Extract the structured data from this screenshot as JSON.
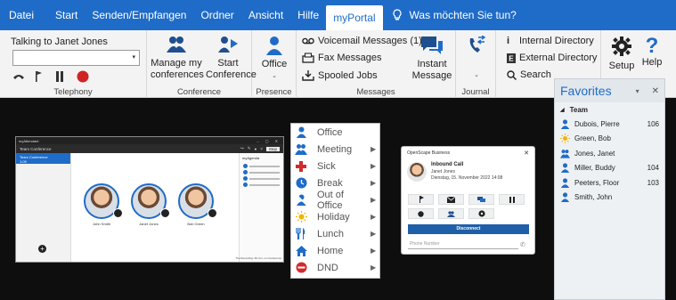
{
  "tabs": [
    "Datei",
    "Start",
    "Senden/Empfangen",
    "Ordner",
    "Ansicht",
    "Hilfe",
    "myPortal"
  ],
  "active_tab": "myPortal",
  "tell_me": "Was möchten Sie tun?",
  "telephony": {
    "talking_to": "Talking to Janet Jones",
    "group_label": "Telephony"
  },
  "conference": {
    "manage_label": "Manage my conferences",
    "start_label": "Start Conference",
    "group_label": "Conference"
  },
  "presence": {
    "office_label": "Office",
    "group_label": "Presence"
  },
  "messages": {
    "voicemail": "Voicemail Messages (1)",
    "fax": "Fax Messages",
    "spooled": "Spooled Jobs",
    "instant": "Instant Message",
    "group_label": "Messages"
  },
  "journal": {
    "group_label": "Journal"
  },
  "directories": {
    "internal": "Internal Directory",
    "external": "External Directory",
    "search": "Search",
    "group_label": "Directo"
  },
  "setup_label": "Setup",
  "help_label": "Help",
  "favorites": {
    "title": "Favorites",
    "group": "Team",
    "entries": [
      {
        "name": "Dubois, Pierre",
        "ext": "106",
        "status": "office"
      },
      {
        "name": "Green, Bob",
        "ext": "",
        "status": "holiday"
      },
      {
        "name": "Jones, Janet",
        "ext": "",
        "status": "meeting"
      },
      {
        "name": "Miller, Buddy",
        "ext": "104",
        "status": "office"
      },
      {
        "name": "Peeters, Floor",
        "ext": "103",
        "status": "office"
      },
      {
        "name": "Smith, John",
        "ext": "",
        "status": "office-person"
      }
    ]
  },
  "status_menu": [
    {
      "label": "Office",
      "icon": "office-icon",
      "color": "#1f6cc8",
      "has_sub": false
    },
    {
      "label": "Meeting",
      "icon": "meeting-icon",
      "color": "#1f6cc8",
      "has_sub": true
    },
    {
      "label": "Sick",
      "icon": "sick-icon",
      "color": "#d12b2b",
      "has_sub": true
    },
    {
      "label": "Break",
      "icon": "break-icon",
      "color": "#1f6cc8",
      "has_sub": true
    },
    {
      "label": "Out of Office",
      "icon": "out-of-office-icon",
      "color": "#1f6cc8",
      "has_sub": true
    },
    {
      "label": "Holiday",
      "icon": "holiday-icon",
      "color": "#f2b400",
      "has_sub": true
    },
    {
      "label": "Lunch",
      "icon": "lunch-icon",
      "color": "#1f6cc8",
      "has_sub": true
    },
    {
      "label": "Home",
      "icon": "home-icon",
      "color": "#1f6cc8",
      "has_sub": true
    },
    {
      "label": "DND",
      "icon": "dnd-icon",
      "color": "#d12b2b",
      "has_sub": true
    }
  ],
  "call_popup": {
    "title": "OpenScape Business",
    "heading": "Inbound Call",
    "caller": "Janet Jones",
    "datetime": "Dienstag, 15. November 2022 14:08",
    "disconnect": "Disconnect",
    "phone_placeholder": "Phone Number"
  },
  "conf_window": {
    "app_title": "myAttendant",
    "bar_title": "Team Conference",
    "side_item": "Team Conference",
    "side_sub": "1:09",
    "right_title": "myAgenda",
    "participants": [
      "John Smith",
      "Janet Jones",
      "Bob Green"
    ],
    "status_text": "The Recording: 99 min, no Conference",
    "end_button": "Stop"
  }
}
